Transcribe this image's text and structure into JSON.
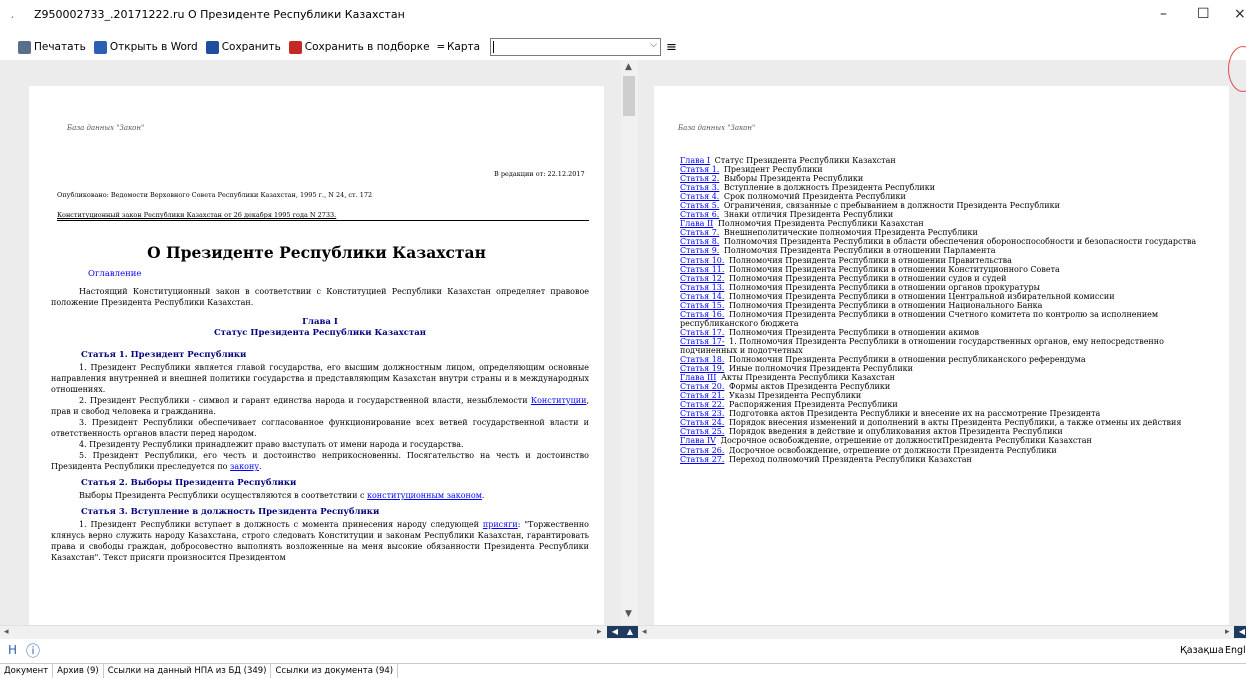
{
  "window": {
    "title": "Z950002733_.20171222.ru  О Президенте Республики Казахстан",
    "minimize": "–",
    "maximize": "☐",
    "close": "×"
  },
  "toolbar": {
    "print": "Печатать",
    "open_word": "Открыть в Word",
    "save": "Сохранить",
    "save_selection": "Сохранить в подборке",
    "map": "Карта",
    "map_value": ""
  },
  "left_doc": {
    "db_label": "База данных \"Закон\"",
    "edition": "В редакции от: 22.12.2017",
    "published": "Опубликовано: Ведомости Верховного Совета Республики Казахстан, 1995 г., N 24, ст. 172",
    "law_ref": "Конституционный закон Республики Казахстан от 26 декабря 1995 года N 2733.",
    "title": "О Президенте Республики Казахстан",
    "toc_link": "Оглавление",
    "intro": "Настоящий Конституционный закон в соответствии с Конституцией Республики Казахстан определяет правовое положение Президента Республики Казахстан.",
    "chapter": "Глава I",
    "chapter_title": "Статус Президента Республики Казахстан",
    "art1": "Статья 1. Президент Республики",
    "art1_p1": "1. Президент Республики является главой государства, его высшим должностным лицом, определяющим основные направления внутренней и внешней политики государства и представляющим Казахстан внутри страны и в международных отношениях.",
    "art1_p2a": "2. Президент Республики - символ и гарант единства народа и государственной власти, незыблемости ",
    "art1_p2link": "Конституции",
    "art1_p2b": ", прав и свобод человека и гражданина.",
    "art1_p3": "3. Президент Республики обеспечивает согласованное функционирование всех ветвей государственной власти и ответственность органов власти перед народом.",
    "art1_p4": "4. Президенту Республики принадлежит право выступать от имени народа и государства.",
    "art1_p5a": "5. Президент Республики, его честь и достоинство неприкосновенны. Посягательство на честь и достоинство Президента Республики преследуется по ",
    "art1_p5link": "закону",
    "art1_p5b": ".",
    "art2": "Статья 2. Выборы Президента Республики",
    "art2_pa": "Выборы Президента Республики осуществляются в соответствии с ",
    "art2_link": "конституционным законом",
    "art2_pb": ".",
    "art3": "Статья 3. Вступление в должность Президента Республики",
    "art3_pa": "1. Президент Республики вступает в должность с момента принесения народу следующей ",
    "art3_link": "присяги",
    "art3_pb": ": \"Торжественно клянусь верно служить народу Казахстана, строго следовать Конституции и законам Республики Казахстан, гарантировать права и свободы граждан, добросовестно выполнять возложенные на меня высокие обязанности Президента Республики Казахстан\". Текст присяги произносится Президентом"
  },
  "right_doc": {
    "db_label": "База данных \"Закон\"",
    "toc": [
      {
        "link": "Глава I",
        "text": " Статус Президента Республики Казахстан"
      },
      {
        "link": "Статья 1.",
        "text": " Президент Республики"
      },
      {
        "link": "Статья 2.",
        "text": " Выборы Президента Республики"
      },
      {
        "link": "Статья 3.",
        "text": " Вступление в должность Президента Республики"
      },
      {
        "link": "Статья 4.",
        "text": " Срок полномочий Президента Республики"
      },
      {
        "link": "Статья 5.",
        "text": " Ограничения, связанные с пребыванием в должности Президента Республики"
      },
      {
        "link": "Статья 6.",
        "text": " Знаки отличия Президента Республики"
      },
      {
        "link": "Глава II",
        "text": " Полномочия Президента Республики Казахстан"
      },
      {
        "link": "Статья 7.",
        "text": " Внешнеполитические полномочия Президента Республики"
      },
      {
        "link": "Статья 8.",
        "text": " Полномочия Президента Республики в области обеспечения обороноспособности и безопасности государства"
      },
      {
        "link": "Статья 9.",
        "text": " Полномочия Президента Республики в отношении Парламента"
      },
      {
        "link": "Статья 10.",
        "text": " Полномочия Президента Республики в отношении Правительства"
      },
      {
        "link": "Статья 11.",
        "text": " Полномочия Президента Республики в отношении Конституционного Совета"
      },
      {
        "link": "Статья 12.",
        "text": " Полномочия Президента Республики в отношении судов и судей"
      },
      {
        "link": "Статья 13.",
        "text": " Полномочия Президента Республики в отношении органов прокуратуры"
      },
      {
        "link": "Статья 14.",
        "text": " Полномочия Президента Республики в отношении Центральной избирательной комиссии"
      },
      {
        "link": "Статья 15.",
        "text": " Полномочия Президента Республики в отношении Национального Банка"
      },
      {
        "link": "Статья 16.",
        "text": " Полномочия Президента Республики в отношении Счетного комитета по контролю за исполнением республиканского бюджета"
      },
      {
        "link": "Статья 17.",
        "text": " Полномочия Президента Республики в отношении акимов"
      },
      {
        "link": "Статья 17-",
        "text": " 1. Полномочия Президента Республики в отношении государственных органов, ему непосредственно подчиненных и подотчетных"
      },
      {
        "link": "Статья 18.",
        "text": " Полномочия Президента Республики в отношении республиканского референдума"
      },
      {
        "link": "Статья 19.",
        "text": " Иные полномочия Президента Республики"
      },
      {
        "link": "Глава III",
        "text": " Акты Президента Республики Казахстан"
      },
      {
        "link": "Статья 20.",
        "text": " Формы актов Президента Республики"
      },
      {
        "link": "Статья 21.",
        "text": " Указы Президента Республики"
      },
      {
        "link": "Статья 22.",
        "text": " Распоряжения Президента Республики"
      },
      {
        "link": "Статья 23.",
        "text": " Подготовка актов Президента Республики и внесение их на рассмотрение Президента"
      },
      {
        "link": "Статья 24.",
        "text": " Порядок внесения изменений и дополнений в акты Президента Республики, а также отмены их действия"
      },
      {
        "link": "Статья 25.",
        "text": " Порядок введения в действие и опубликования актов Президента Республики"
      },
      {
        "link": "Глава IV",
        "text": " Досрочное освобождение, отрешение от должностиПрезидента Республики Казахстан"
      },
      {
        "link": "Статья 26.",
        "text": " Досрочное освобождение, отрешение от должности Президента Республики"
      },
      {
        "link": "Статья 27.",
        "text": " Переход полномочий Президента Республики Казахстан"
      }
    ]
  },
  "status": {
    "lang_kz": "Қазақша",
    "lang_en": "Engli"
  },
  "tabs": [
    {
      "label": "Документ"
    },
    {
      "label": "Архив (9)"
    },
    {
      "label": "Ссылки на данный НПА из БД (349)"
    },
    {
      "label": "Ссылки из документа (94)"
    }
  ]
}
